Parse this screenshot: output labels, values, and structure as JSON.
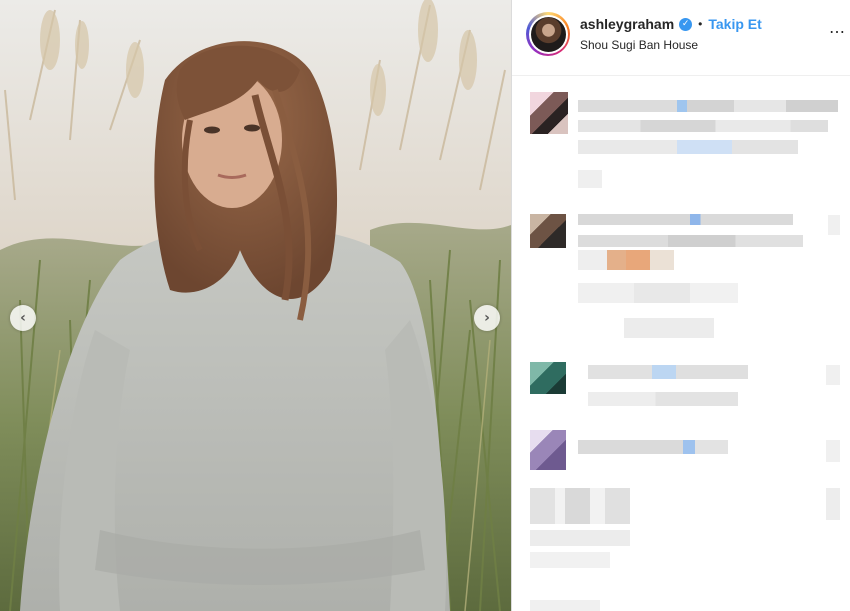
{
  "post": {
    "username": "ashleygraham",
    "follow_label": "Takip Et",
    "separator": "•",
    "location": "Shou Sugi Ban House",
    "more_icon": "more-options-icon"
  },
  "carousel": {
    "prev_glyph": "‹",
    "next_glyph": "›"
  },
  "colors": {
    "accent_blue": "#3897f0",
    "text_dark": "#262626",
    "border": "#efefef"
  }
}
